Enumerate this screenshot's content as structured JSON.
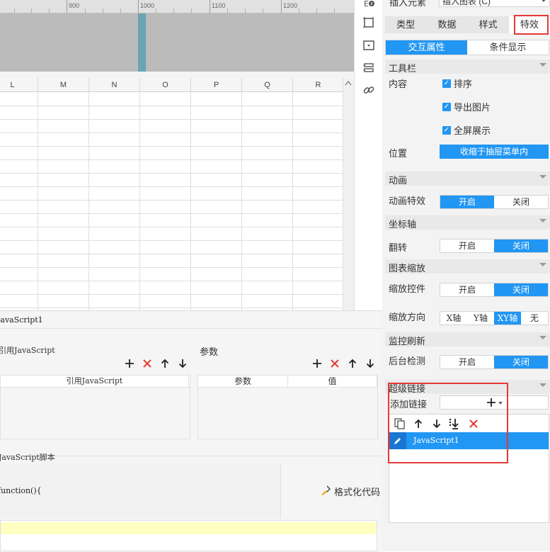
{
  "ruler": {
    "ticks": [
      "900",
      "1000",
      "1100",
      "1200"
    ]
  },
  "grid": {
    "columns": [
      "L",
      "M",
      "N",
      "O",
      "P",
      "Q",
      "R"
    ]
  },
  "bottom": {
    "tab_title": "JavaScript1",
    "ref_js_title": "引用JavaScript",
    "ref_js_col": "引用JavaScript",
    "params_title": "参数",
    "params_cols": [
      "参数",
      "值"
    ],
    "script_title": "JavaScript脚本",
    "code_text": "function(){",
    "format_code_label": "格式化代码"
  },
  "panel": {
    "top_label": "插入元素",
    "top_select_value": "插入图表 (C)",
    "tabs": [
      "类型",
      "数据",
      "样式",
      "特效"
    ],
    "active_tab": "特效",
    "subtabs": [
      "交互属性",
      "条件显示"
    ],
    "toolbar": {
      "title": "工具栏",
      "content_label": "内容",
      "options": [
        "排序",
        "导出图片",
        "全屏展示"
      ],
      "position_label": "位置",
      "position_value": "收缩于抽屉菜单内"
    },
    "animation": {
      "title": "动画",
      "label": "动画特效",
      "options": [
        "开启",
        "关闭"
      ]
    },
    "axis": {
      "title": "坐标轴",
      "label": "翻转",
      "options": [
        "开启",
        "关闭"
      ]
    },
    "zoom": {
      "title": "图表缩放",
      "control_label": "缩放控件",
      "control_options": [
        "开启",
        "关闭"
      ],
      "direction_label": "缩放方向",
      "direction_options": [
        "X轴",
        "Y轴",
        "XY轴",
        "无"
      ]
    },
    "refresh": {
      "title": "监控刷新",
      "label": "后台检测",
      "options": [
        "开启",
        "关闭"
      ]
    },
    "hyperlink": {
      "title": "超级链接",
      "add_label": "添加链接",
      "item": "JavaScript1"
    }
  },
  "colors": {
    "accent": "#2196f3",
    "highlight": "#e53935",
    "code_line": "#ffffc2"
  }
}
